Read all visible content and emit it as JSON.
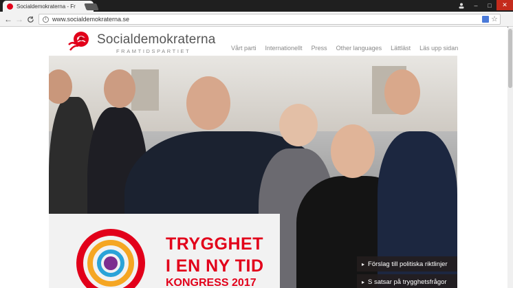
{
  "browser": {
    "tab_title": "Socialdemokraterna - Fr",
    "tab_close": "×",
    "url": "www.socialdemokraterna.se",
    "win_min": "–",
    "win_max": "□",
    "win_close": "✕",
    "back": "←",
    "forward": "→",
    "reload": "C",
    "menu": "⋮",
    "star": "☆"
  },
  "site": {
    "brand_name": "Socialdemokraterna",
    "tagline": "FRAMTIDSPARTIET",
    "nav": [
      "Vårt parti",
      "Internationellt",
      "Press",
      "Other languages",
      "Lättläst",
      "Läs upp sidan"
    ]
  },
  "hero": {
    "poster_line1": "TRYGGHET",
    "poster_line2": "I EN NY TID",
    "poster_line3": "KONGRESS 2017",
    "links": [
      "Förslag till politiska riktlinjer",
      "S satsar på trygghetsfrågor"
    ],
    "link_arrow": "▸"
  },
  "colors": {
    "brand_red": "#e2001a"
  }
}
